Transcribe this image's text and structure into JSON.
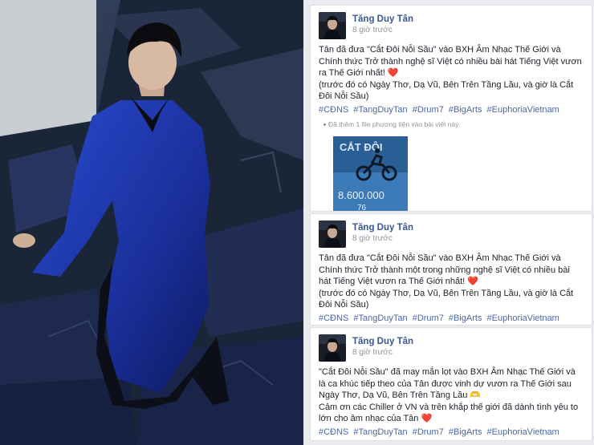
{
  "posts": [
    {
      "author": "Tăng Duy Tân",
      "time": "8 giờ trước",
      "text": "Tân đã đưa \"Cắt Đôi Nỗi Sầu\" vào BXH Âm Nhạc Thế Giới và Chính thức Trở thành nghệ sĩ Việt có nhiều bài hát Tiếng Việt vươn ra Thế Giới nhất! ❤️\n(trước đó có Ngày Thơ, Dạ Vũ, Bên Trên Tầng Lầu, và giờ là Cắt Đôi Nỗi Sầu)",
      "hashtags": [
        "#CĐNS",
        "#TangDuyTan",
        "#Drum7",
        "#BigArts",
        "#EuphoriaVietnam"
      ],
      "attachment_note": "Đã thêm 1 file phương tiện vào bài viết này.",
      "thumbnail": {
        "title": "CẮT ĐÔI",
        "count": "8.600.000",
        "footer": "76"
      }
    },
    {
      "author": "Tăng Duy Tân",
      "time": "8 giờ trước",
      "text": "Tân đã đưa \"Cắt Đôi Nỗi Sầu\" vào BXH Âm Nhạc Thế Giới và Chính thức Trở thành một trong những nghệ sĩ Việt có nhiều bài hát Tiếng Việt vươn ra Thế Giới nhất! ❤️\n(trước đó có Ngày Thơ, Dạ Vũ, Bên Trên Tầng Lầu, và giờ là Cắt Đôi Nỗi Sầu)",
      "hashtags": [
        "#CĐNS",
        "#TangDuyTan",
        "#Drum7",
        "#BigArts",
        "#EuphoriaVietnam"
      ]
    },
    {
      "author": "Tăng Duy Tân",
      "time": "8 giờ trước",
      "text": "\"Cắt Đôi Nỗi Sầu\" đã may mắn lọt vào BXH Âm Nhạc Thế Giới và là ca khúc tiếp theo của Tân được vinh dự vươn ra Thế Giới sau Ngày Thơ, Dạ Vũ, Bên Trên Tầng Lầu 🫶\nCảm ơn các Chiller ở VN và trên khắp thế giới đã dành tình yêu to lớn cho âm nhạc của Tân ❤️",
      "hashtags": [
        "#CĐNS",
        "#TangDuyTan",
        "#Drum7",
        "#BigArts",
        "#EuphoriaVietnam"
      ]
    }
  ],
  "colors": {
    "author": "#365899",
    "hashtag": "#4a67a8",
    "muted": "#90949c",
    "feed_bg": "#e9ebee",
    "suit_blue": "#1e3aa8"
  },
  "icons": {
    "avatar": "profile-photo",
    "bullet": "attachment-bullet-icon"
  }
}
